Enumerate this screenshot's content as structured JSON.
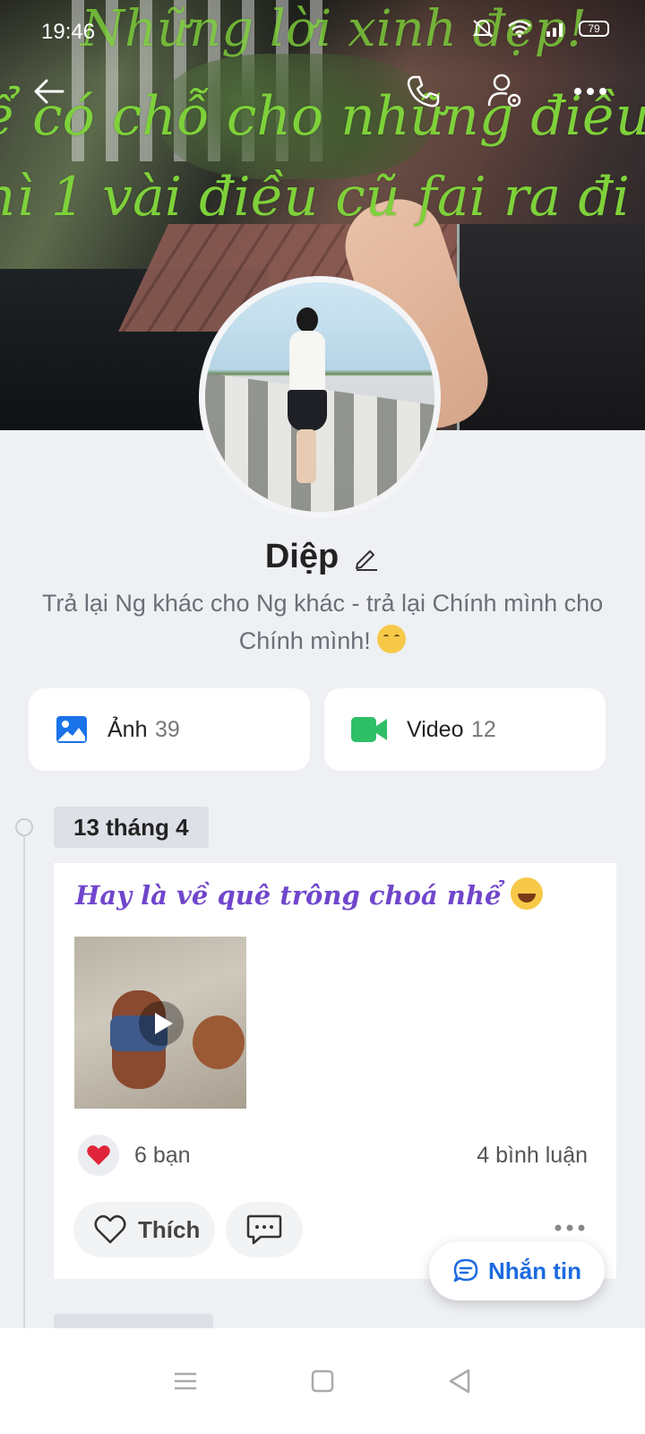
{
  "status_bar": {
    "time": "19:46",
    "battery": "79"
  },
  "cover": {
    "line1": "Những lời xinh đẹp!",
    "line2": "ể có chỗ cho những điều m",
    "line3": "hì 1 vài điều cũ fai ra đi !"
  },
  "topbar": {
    "back_icon": "arrow-left-icon",
    "call_icon": "phone-icon",
    "settings_icon": "user-settings-icon",
    "more_icon": "more-horizontal-icon"
  },
  "profile": {
    "name": "Diệp",
    "bio": "Trả lại Ng khác cho Ng khác - trả lại Chính mình cho Chính mình!"
  },
  "media": {
    "photos_label": "Ảnh",
    "photos_count": "39",
    "videos_label": "Video",
    "videos_count": "12"
  },
  "timeline": {
    "date": "13 tháng 4"
  },
  "post": {
    "text": "Hay là về quê trông choá nhể",
    "reaction_count": "6 bạn",
    "comment_count": "4 bình luận",
    "like_label": "Thích"
  },
  "message_button": {
    "label": "Nhắn tin"
  },
  "colors": {
    "accent": "#1c6ae0",
    "post_text": "#7046cc",
    "cover_text": "#7ed13a",
    "video_icon": "#2fbf66",
    "photo_icon": "#1a73e8"
  }
}
